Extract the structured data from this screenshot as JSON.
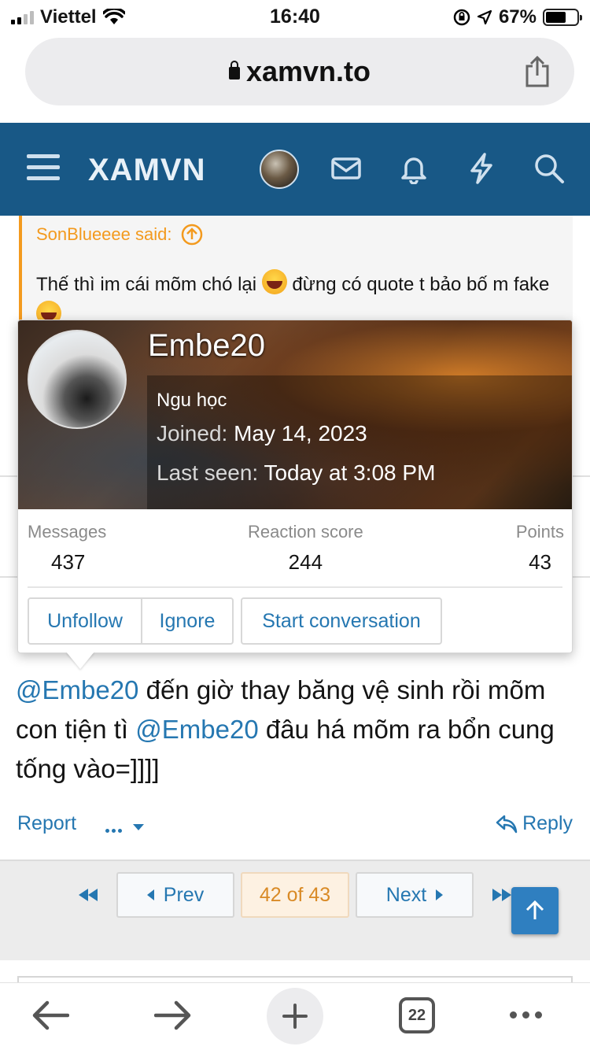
{
  "status_bar": {
    "carrier": "Viettel",
    "time": "16:40",
    "battery": "67%",
    "battery_level": 0.67
  },
  "browser": {
    "url": "xamvn.to"
  },
  "site": {
    "logo": "XAMVN"
  },
  "quote": {
    "author_said": "SonBlueeee said:",
    "text_part1": "Thế thì im cái mõm chó lại ",
    "text_part2": " đừng có quote t bảo bố m fake "
  },
  "member_card": {
    "name": "Embe20",
    "user_title": "Ngu học",
    "joined_label": "Joined:",
    "joined_value": "May 14, 2023",
    "last_seen_label": "Last seen:",
    "last_seen_value": "Today at 3:08 PM",
    "stats": [
      {
        "label": "Messages",
        "value": "437"
      },
      {
        "label": "Reaction score",
        "value": "244"
      },
      {
        "label": "Points",
        "value": "43"
      }
    ],
    "buttons": {
      "unfollow": "Unfollow",
      "ignore": "Ignore",
      "start_conversation": "Start conversation"
    }
  },
  "post": {
    "mention1": "@Embe20",
    "text1": " đến giờ thay băng vệ sinh rồi mõm con tiện tì ",
    "mention2": "@Embe20",
    "text2": " đâu há mõm ra bổn cung tống vào=]]]]",
    "actions": {
      "report": "Report",
      "reply": "Reply"
    }
  },
  "pagination": {
    "prev": "Prev",
    "current": "42 of 43",
    "next": "Next"
  },
  "toolbar": {
    "tabs_count": "22"
  },
  "colors": {
    "header_blue": "#185886",
    "link_blue": "#2577b1",
    "quote_orange": "#f39a1e"
  }
}
